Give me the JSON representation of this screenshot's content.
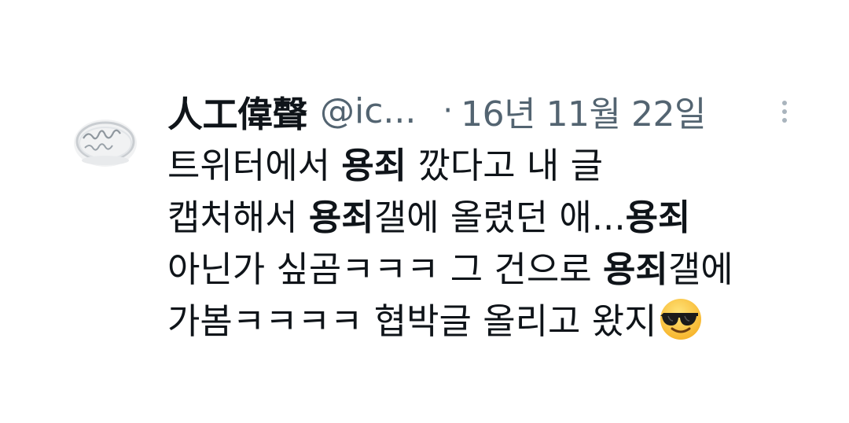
{
  "tweet": {
    "display_name": "人工偉聲",
    "handle": "@ic...",
    "separator": "·",
    "timestamp": "16년 11월 22일",
    "avatar_icon": "ring-photo-avatar",
    "more_icon": "more-vertical-icon",
    "lines": [
      {
        "t1": "트위터에서 ",
        "b1": "용죄",
        "t2": " 깠다고 내 글"
      },
      {
        "t1": "캡처해서 ",
        "b1": "용죄",
        "t2": "갤에 올렸던 애...",
        "b2": "용죄"
      },
      {
        "t1": "아닌가 싶곰ㅋㅋㅋ 그 건으로 ",
        "b1": "용죄",
        "t2": "갤에"
      },
      {
        "t1": "가봄ㅋㅋㅋㅋ 협박글 올리고 왔지",
        "emoji": "smiling-face-with-sunglasses-emoji"
      }
    ]
  }
}
